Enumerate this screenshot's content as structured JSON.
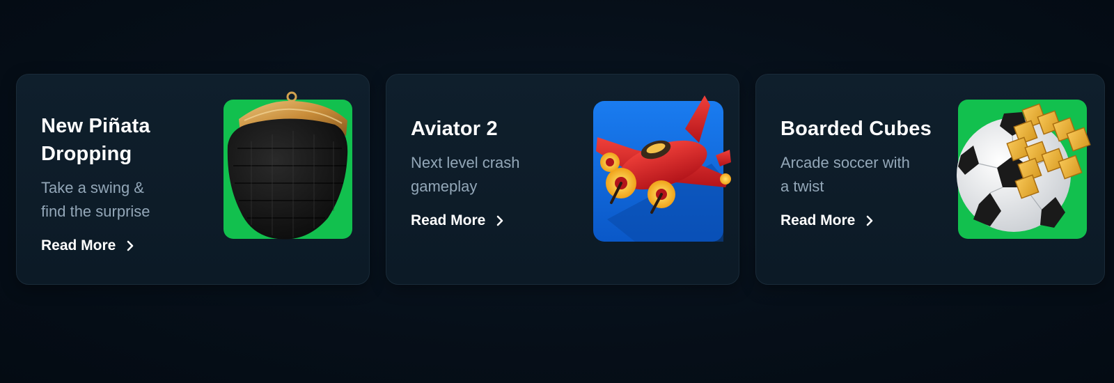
{
  "cards": [
    {
      "title_line1": "New Piñata",
      "title_line2": "Dropping",
      "desc_line1": "Take a swing &",
      "desc_line2": "find the surprise",
      "cta": "Read More",
      "image_icon": "pinata-icon",
      "image_bg": "#12c04e"
    },
    {
      "title_line1": "Aviator 2",
      "title_line2": "",
      "desc_line1": "Next level crash",
      "desc_line2": "gameplay",
      "cta": "Read More",
      "image_icon": "airplane-icon",
      "image_bg": "#0f6fe6"
    },
    {
      "title_line1": "Boarded Cubes",
      "title_line2": "",
      "desc_line1": "Arcade soccer with",
      "desc_line2": "a twist",
      "cta": "Read More",
      "image_icon": "soccer-ball-icon",
      "image_bg": "#12c04e"
    }
  ],
  "colors": {
    "background": "#050d16",
    "card": "#0e1d2a",
    "title": "#ffffff",
    "description": "#93a7b8",
    "green_tile": "#12c04e",
    "blue_tile": "#0f6fe6"
  }
}
